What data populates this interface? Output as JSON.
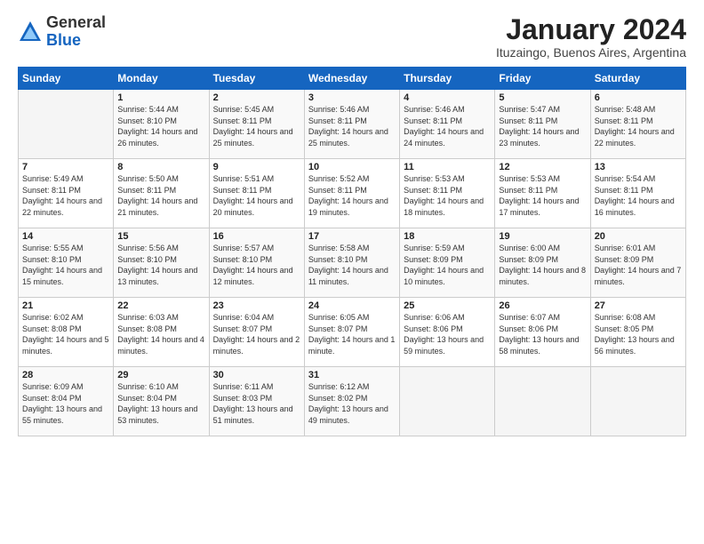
{
  "logo": {
    "general": "General",
    "blue": "Blue"
  },
  "header": {
    "title": "January 2024",
    "location": "Ituzaingo, Buenos Aires, Argentina"
  },
  "weekdays": [
    "Sunday",
    "Monday",
    "Tuesday",
    "Wednesday",
    "Thursday",
    "Friday",
    "Saturday"
  ],
  "weeks": [
    [
      {
        "day": "",
        "sunrise": "",
        "sunset": "",
        "daylight": ""
      },
      {
        "day": "1",
        "sunrise": "Sunrise: 5:44 AM",
        "sunset": "Sunset: 8:10 PM",
        "daylight": "Daylight: 14 hours and 26 minutes."
      },
      {
        "day": "2",
        "sunrise": "Sunrise: 5:45 AM",
        "sunset": "Sunset: 8:11 PM",
        "daylight": "Daylight: 14 hours and 25 minutes."
      },
      {
        "day": "3",
        "sunrise": "Sunrise: 5:46 AM",
        "sunset": "Sunset: 8:11 PM",
        "daylight": "Daylight: 14 hours and 25 minutes."
      },
      {
        "day": "4",
        "sunrise": "Sunrise: 5:46 AM",
        "sunset": "Sunset: 8:11 PM",
        "daylight": "Daylight: 14 hours and 24 minutes."
      },
      {
        "day": "5",
        "sunrise": "Sunrise: 5:47 AM",
        "sunset": "Sunset: 8:11 PM",
        "daylight": "Daylight: 14 hours and 23 minutes."
      },
      {
        "day": "6",
        "sunrise": "Sunrise: 5:48 AM",
        "sunset": "Sunset: 8:11 PM",
        "daylight": "Daylight: 14 hours and 22 minutes."
      }
    ],
    [
      {
        "day": "7",
        "sunrise": "Sunrise: 5:49 AM",
        "sunset": "Sunset: 8:11 PM",
        "daylight": "Daylight: 14 hours and 22 minutes."
      },
      {
        "day": "8",
        "sunrise": "Sunrise: 5:50 AM",
        "sunset": "Sunset: 8:11 PM",
        "daylight": "Daylight: 14 hours and 21 minutes."
      },
      {
        "day": "9",
        "sunrise": "Sunrise: 5:51 AM",
        "sunset": "Sunset: 8:11 PM",
        "daylight": "Daylight: 14 hours and 20 minutes."
      },
      {
        "day": "10",
        "sunrise": "Sunrise: 5:52 AM",
        "sunset": "Sunset: 8:11 PM",
        "daylight": "Daylight: 14 hours and 19 minutes."
      },
      {
        "day": "11",
        "sunrise": "Sunrise: 5:53 AM",
        "sunset": "Sunset: 8:11 PM",
        "daylight": "Daylight: 14 hours and 18 minutes."
      },
      {
        "day": "12",
        "sunrise": "Sunrise: 5:53 AM",
        "sunset": "Sunset: 8:11 PM",
        "daylight": "Daylight: 14 hours and 17 minutes."
      },
      {
        "day": "13",
        "sunrise": "Sunrise: 5:54 AM",
        "sunset": "Sunset: 8:11 PM",
        "daylight": "Daylight: 14 hours and 16 minutes."
      }
    ],
    [
      {
        "day": "14",
        "sunrise": "Sunrise: 5:55 AM",
        "sunset": "Sunset: 8:10 PM",
        "daylight": "Daylight: 14 hours and 15 minutes."
      },
      {
        "day": "15",
        "sunrise": "Sunrise: 5:56 AM",
        "sunset": "Sunset: 8:10 PM",
        "daylight": "Daylight: 14 hours and 13 minutes."
      },
      {
        "day": "16",
        "sunrise": "Sunrise: 5:57 AM",
        "sunset": "Sunset: 8:10 PM",
        "daylight": "Daylight: 14 hours and 12 minutes."
      },
      {
        "day": "17",
        "sunrise": "Sunrise: 5:58 AM",
        "sunset": "Sunset: 8:10 PM",
        "daylight": "Daylight: 14 hours and 11 minutes."
      },
      {
        "day": "18",
        "sunrise": "Sunrise: 5:59 AM",
        "sunset": "Sunset: 8:09 PM",
        "daylight": "Daylight: 14 hours and 10 minutes."
      },
      {
        "day": "19",
        "sunrise": "Sunrise: 6:00 AM",
        "sunset": "Sunset: 8:09 PM",
        "daylight": "Daylight: 14 hours and 8 minutes."
      },
      {
        "day": "20",
        "sunrise": "Sunrise: 6:01 AM",
        "sunset": "Sunset: 8:09 PM",
        "daylight": "Daylight: 14 hours and 7 minutes."
      }
    ],
    [
      {
        "day": "21",
        "sunrise": "Sunrise: 6:02 AM",
        "sunset": "Sunset: 8:08 PM",
        "daylight": "Daylight: 14 hours and 5 minutes."
      },
      {
        "day": "22",
        "sunrise": "Sunrise: 6:03 AM",
        "sunset": "Sunset: 8:08 PM",
        "daylight": "Daylight: 14 hours and 4 minutes."
      },
      {
        "day": "23",
        "sunrise": "Sunrise: 6:04 AM",
        "sunset": "Sunset: 8:07 PM",
        "daylight": "Daylight: 14 hours and 2 minutes."
      },
      {
        "day": "24",
        "sunrise": "Sunrise: 6:05 AM",
        "sunset": "Sunset: 8:07 PM",
        "daylight": "Daylight: 14 hours and 1 minute."
      },
      {
        "day": "25",
        "sunrise": "Sunrise: 6:06 AM",
        "sunset": "Sunset: 8:06 PM",
        "daylight": "Daylight: 13 hours and 59 minutes."
      },
      {
        "day": "26",
        "sunrise": "Sunrise: 6:07 AM",
        "sunset": "Sunset: 8:06 PM",
        "daylight": "Daylight: 13 hours and 58 minutes."
      },
      {
        "day": "27",
        "sunrise": "Sunrise: 6:08 AM",
        "sunset": "Sunset: 8:05 PM",
        "daylight": "Daylight: 13 hours and 56 minutes."
      }
    ],
    [
      {
        "day": "28",
        "sunrise": "Sunrise: 6:09 AM",
        "sunset": "Sunset: 8:04 PM",
        "daylight": "Daylight: 13 hours and 55 minutes."
      },
      {
        "day": "29",
        "sunrise": "Sunrise: 6:10 AM",
        "sunset": "Sunset: 8:04 PM",
        "daylight": "Daylight: 13 hours and 53 minutes."
      },
      {
        "day": "30",
        "sunrise": "Sunrise: 6:11 AM",
        "sunset": "Sunset: 8:03 PM",
        "daylight": "Daylight: 13 hours and 51 minutes."
      },
      {
        "day": "31",
        "sunrise": "Sunrise: 6:12 AM",
        "sunset": "Sunset: 8:02 PM",
        "daylight": "Daylight: 13 hours and 49 minutes."
      },
      {
        "day": "",
        "sunrise": "",
        "sunset": "",
        "daylight": ""
      },
      {
        "day": "",
        "sunrise": "",
        "sunset": "",
        "daylight": ""
      },
      {
        "day": "",
        "sunrise": "",
        "sunset": "",
        "daylight": ""
      }
    ]
  ]
}
